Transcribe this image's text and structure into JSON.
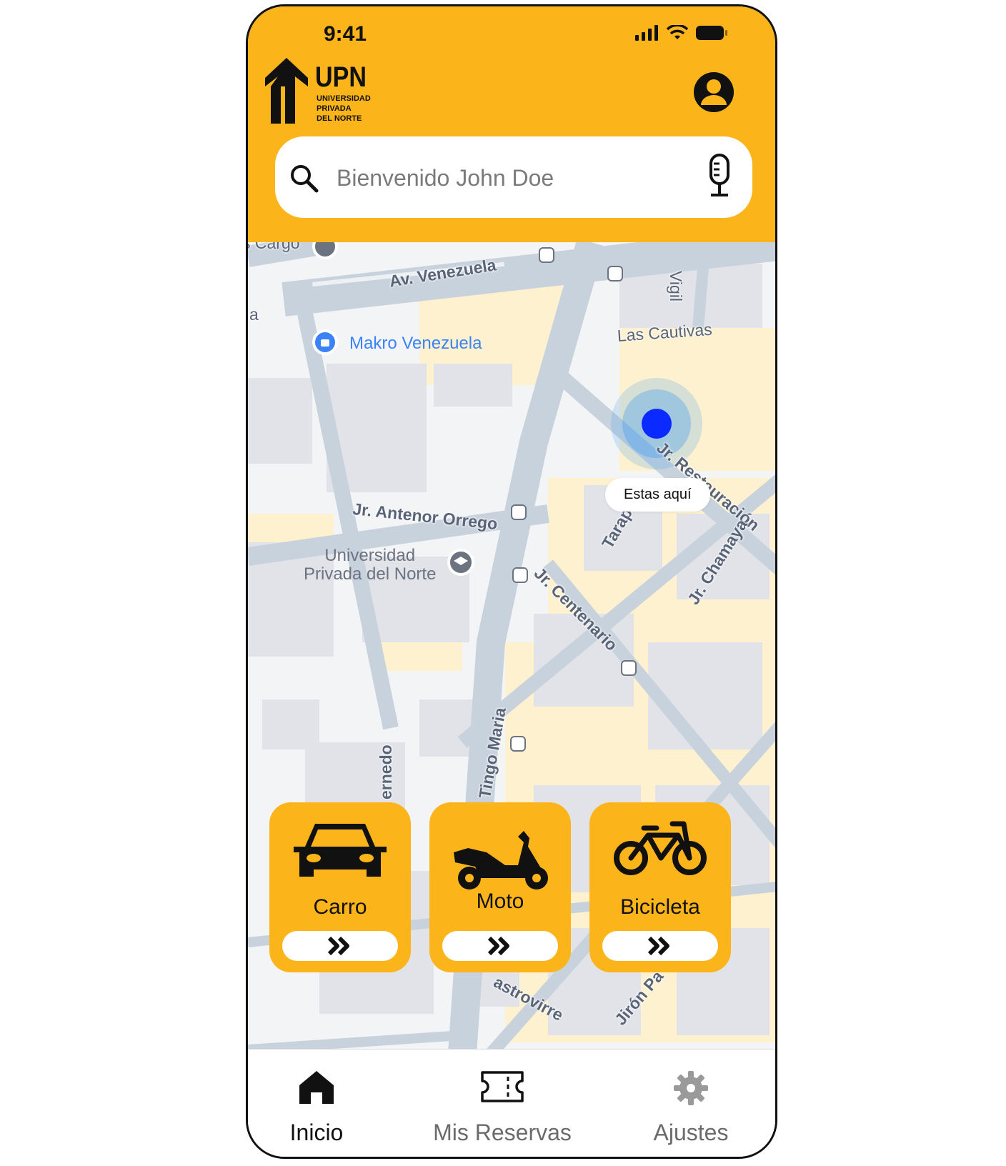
{
  "status_bar": {
    "time": "9:41"
  },
  "header": {
    "logo": {
      "mark": "UPN",
      "line1": "UNIVERSIDAD",
      "line2": "PRIVADA",
      "line3": "DEL NORTE"
    },
    "profile_icon": "person-circle-icon"
  },
  "search": {
    "placeholder": "Bienvenido John Doe",
    "value": ""
  },
  "map": {
    "labels": {
      "cargo": "s Cargo",
      "venezuela": "Av. Venezuela",
      "vigil": "Vigil",
      "cautivas": "Las Cautivas",
      "makro": "Makro Venezuela",
      "restauracion": "Jr. Restauración",
      "antenor": "Jr. Antenor Orrego",
      "upn_1": "Universidad",
      "upn_2": "Privada del Norte",
      "tarapaca": "Tarap",
      "chamaya": "Jr. Chamaya",
      "centenario": "Jr. Centenario",
      "tingo": "Tingo Maria",
      "bernedo": "ernedo",
      "castrovirreyna": "astrovirre",
      "jiron": "Jirón Pa",
      "letter_a": "a"
    },
    "location_marker": {
      "label": "Estas aquí",
      "color": "#0a2aff"
    }
  },
  "vehicles": [
    {
      "label": "Carro",
      "icon": "car-icon"
    },
    {
      "label": "Moto",
      "icon": "scooter-icon"
    },
    {
      "label": "Bicicleta",
      "icon": "bicycle-icon"
    }
  ],
  "tabbar": {
    "tabs": [
      {
        "label": "Inicio",
        "icon": "home-icon",
        "active": true
      },
      {
        "label": "Mis Reservas",
        "icon": "ticket-icon",
        "active": false
      },
      {
        "label": "Ajustes",
        "icon": "gear-icon",
        "active": false
      }
    ]
  },
  "colors": {
    "accent": "#fbb51b",
    "map_road": "#c8d2dd",
    "map_block": "#fdf1cf",
    "inactive": "#6b6b6b"
  }
}
